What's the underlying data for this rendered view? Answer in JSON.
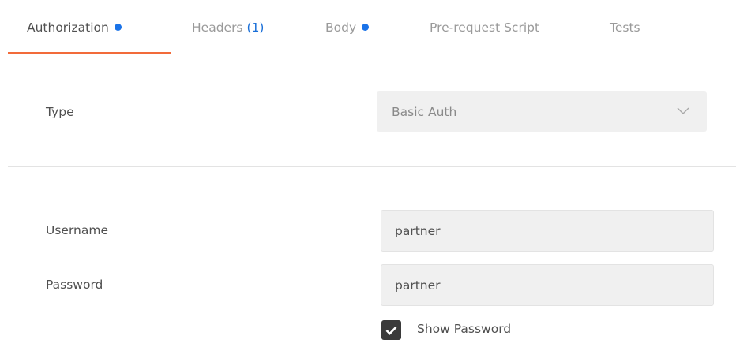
{
  "tabs": [
    {
      "label": "Authorization",
      "indicator": "dot",
      "active": true
    },
    {
      "label": "Headers",
      "count": "(1)",
      "active": false
    },
    {
      "label": "Body",
      "indicator": "dot",
      "active": false
    },
    {
      "label": "Pre-request Script",
      "active": false
    },
    {
      "label": "Tests",
      "active": false
    }
  ],
  "auth": {
    "type_label": "Type",
    "type_value": "Basic Auth",
    "username_label": "Username",
    "username_value": "partner",
    "password_label": "Password",
    "password_value": "partner",
    "show_password_label": "Show Password",
    "show_password_checked": true
  },
  "colors": {
    "accent": "#f26b3a",
    "dot": "#1a73e8",
    "count": "#1a6fd8",
    "checkbox": "#3a3a3a"
  },
  "icons": {
    "dropdown": "chevron-down-icon",
    "check": "check-icon",
    "indicator": "blue-dot-icon"
  }
}
